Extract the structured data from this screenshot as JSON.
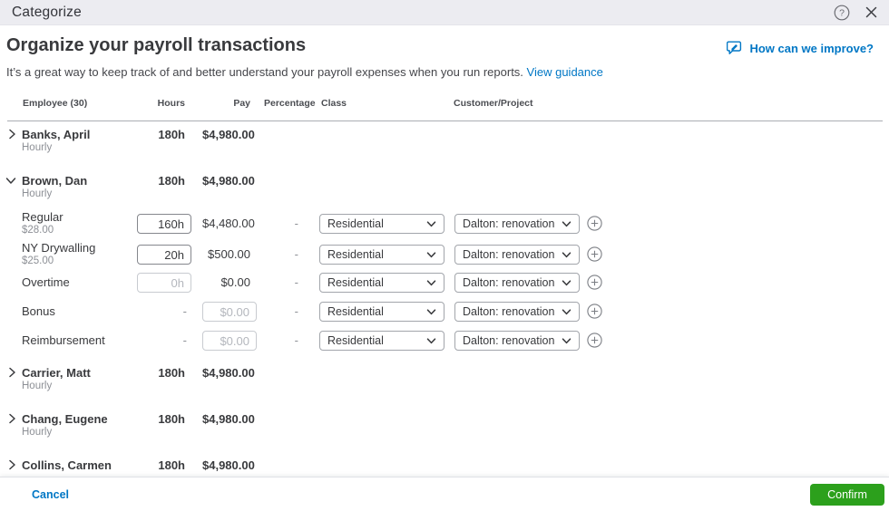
{
  "titlebar": {
    "title": "Categorize"
  },
  "header": {
    "title": "Organize your payroll transactions",
    "subtitle": "It’s a great way to keep track of and better understand your payroll expenses when you run reports.",
    "guidance_link": "View guidance",
    "improve_link": "How can we improve?"
  },
  "table": {
    "headers": {
      "employee": "Employee (30)",
      "hours": "Hours",
      "pay": "Pay",
      "percentage": "Percentage",
      "class": "Class",
      "customer": "Customer/Project"
    }
  },
  "employees": [
    {
      "name": "Banks, April",
      "type": "Hourly",
      "hours": "180h",
      "pay": "$4,980.00",
      "expanded": false
    },
    {
      "name": "Brown, Dan",
      "type": "Hourly",
      "hours": "180h",
      "pay": "$4,980.00",
      "expanded": true,
      "details": [
        {
          "label": "Regular",
          "rate": "$28.00",
          "hours_input": {
            "value": "160h",
            "disabled": false
          },
          "pay_text": "$4,480.00",
          "percentage": "-",
          "class": "Residential",
          "customer": "Dalton: renovation"
        },
        {
          "label": "NY Drywalling",
          "rate": "$25.00",
          "hours_input": {
            "value": "20h",
            "disabled": false
          },
          "pay_text": "$500.00",
          "percentage": "-",
          "class": "Residential",
          "customer": "Dalton: renovation"
        },
        {
          "label": "Overtime",
          "hours_input": {
            "value": "0h",
            "disabled": true
          },
          "pay_text": "$0.00",
          "percentage": "-",
          "class": "Residential",
          "customer": "Dalton: renovation"
        },
        {
          "label": "Bonus",
          "hours_dash": "-",
          "pay_input": {
            "value": "$0.00",
            "disabled": true
          },
          "percentage": "-",
          "class": "Residential",
          "customer": "Dalton: renovation"
        },
        {
          "label": "Reimbursement",
          "hours_dash": "-",
          "pay_input": {
            "value": "$0.00",
            "disabled": true
          },
          "percentage": "-",
          "class": "Residential",
          "customer": "Dalton: renovation"
        }
      ]
    },
    {
      "name": "Carrier, Matt",
      "type": "Hourly",
      "hours": "180h",
      "pay": "$4,980.00",
      "expanded": false
    },
    {
      "name": "Chang, Eugene",
      "type": "Hourly",
      "hours": "180h",
      "pay": "$4,980.00",
      "expanded": false
    },
    {
      "name": "Collins, Carmen",
      "type": "",
      "hours": "180h",
      "pay": "$4,980.00",
      "expanded": false
    }
  ],
  "footer": {
    "cancel": "Cancel",
    "confirm": "Confirm"
  },
  "colors": {
    "accent_green": "#2ca01c",
    "link_blue": "#0077c5",
    "text_dark": "#393a3d",
    "text_gray": "#8d9096",
    "titlebar_bg": "#ececf1"
  }
}
